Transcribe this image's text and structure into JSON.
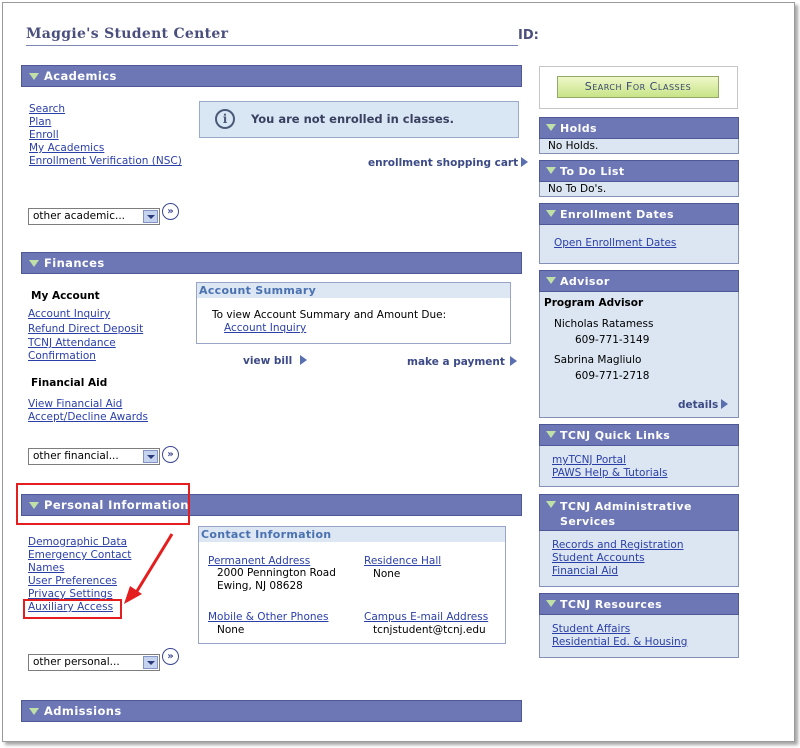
{
  "header": {
    "title": "Maggie's Student Center",
    "id_label": "ID:"
  },
  "academics": {
    "title": "Academics",
    "links": [
      "Search",
      "Plan",
      "Enroll",
      "My Academics",
      "Enrollment Verification (NSC)"
    ],
    "info_message": "You are not enrolled in classes.",
    "cart_link": "enrollment shopping cart",
    "dropdown_value": "other academic..."
  },
  "finances": {
    "title": "Finances",
    "my_account_heading": "My Account",
    "my_account_links": [
      "Account Inquiry",
      "Refund Direct Deposit",
      "TCNJ Attendance",
      "Confirmation"
    ],
    "financial_aid_heading": "Financial Aid",
    "financial_aid_links": [
      "View Financial Aid",
      "Accept/Decline Awards"
    ],
    "dropdown_value": "other financial...",
    "summary_title": "Account Summary",
    "summary_text": "To view Account Summary and Amount Due:",
    "summary_link": "Account Inquiry",
    "view_bill": "view bill",
    "make_payment": "make a payment"
  },
  "personal": {
    "title": "Personal Information",
    "links": [
      "Demographic Data",
      "Emergency Contact",
      "Names",
      "User Preferences",
      "Privacy Settings",
      "Auxiliary Access"
    ],
    "dropdown_value": "other personal...",
    "contact_title": "Contact Information",
    "permanent_address_label": "Permanent Address",
    "permanent_address_line1": "2000 Pennington Road",
    "permanent_address_line2": "Ewing, NJ 08628",
    "residence_hall_label": "Residence Hall",
    "residence_hall_value": "None",
    "phones_label": "Mobile & Other Phones",
    "phones_value": "None",
    "email_label": "Campus E-mail Address",
    "email_value": "tcnjstudent@tcnj.edu"
  },
  "admissions": {
    "title": "Admissions"
  },
  "sidebar": {
    "search_button": "Search For Classes",
    "holds_title": "Holds",
    "holds_value": "No Holds.",
    "todo_title": "To Do List",
    "todo_value": "No To Do's.",
    "enroll_dates_title": "Enrollment Dates",
    "enroll_dates_link": "Open Enrollment Dates",
    "advisor_title": "Advisor",
    "advisor_heading": "Program Advisor",
    "advisors": [
      {
        "name": "Nicholas Ratamess",
        "phone": "609-771-3149"
      },
      {
        "name": "Sabrina Magliulo",
        "phone": "609-771-2718"
      }
    ],
    "details_link": "details",
    "quick_links_title": "TCNJ Quick Links",
    "quick_links": [
      "myTCNJ Portal",
      "PAWS Help & Tutorials"
    ],
    "admin_title": "TCNJ Administrative Services",
    "admin_links": [
      "Records and Registration",
      "Student Accounts",
      "Financial Aid"
    ],
    "resources_title": "TCNJ Resources",
    "resources_links": [
      "Student Affairs",
      "Residential Ed. & Housing"
    ]
  },
  "colors": {
    "header_bar": "#6d77b6",
    "panel_bg": "#dbe6f2",
    "highlight": "#e41e1e",
    "link": "#2b3fa8"
  }
}
